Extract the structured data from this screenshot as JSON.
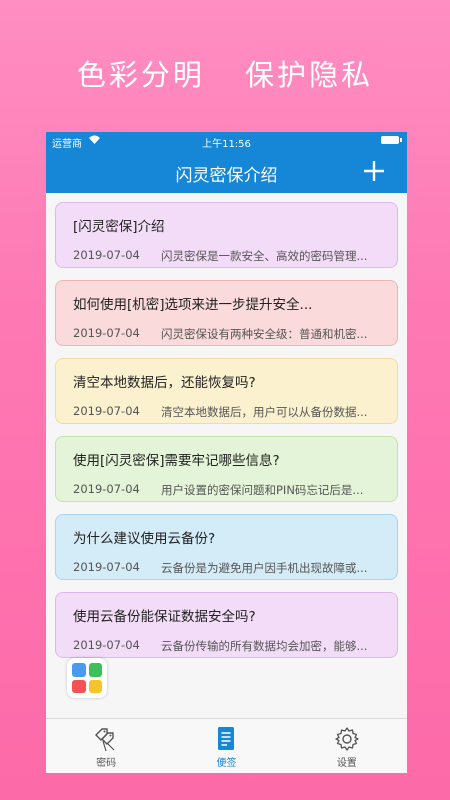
{
  "promo": {
    "left": "色彩分明",
    "right": "保护隐私"
  },
  "status_bar": {
    "carrier": "运营商",
    "time": "上午11:56"
  },
  "navbar": {
    "title": "闪灵密保介绍",
    "add_icon": "plus-icon"
  },
  "notes": [
    {
      "title": "[闪灵密保]介绍",
      "date": "2019-07-04",
      "summary": "闪灵密保是一款安全、高效的密码管理...",
      "bg": "#f3dcf8",
      "border": "#dfb8ea"
    },
    {
      "title": "如何使用[机密]选项来进一步提升安全...",
      "date": "2019-07-04",
      "summary": "闪灵密保设有两种安全级：普通和机密...",
      "bg": "#fadadb",
      "border": "#f0b4b6"
    },
    {
      "title": "清空本地数据后，还能恢复吗?",
      "date": "2019-07-04",
      "summary": "清空本地数据后，用户可以从备份数据...",
      "bg": "#fbf1cf",
      "border": "#efdca0"
    },
    {
      "title": "使用[闪灵密保]需要牢记哪些信息?",
      "date": "2019-07-04",
      "summary": "用户设置的密保问题和PIN码忘记后是...",
      "bg": "#e4f4d8",
      "border": "#c3e3ad"
    },
    {
      "title": "为什么建议使用云备份?",
      "date": "2019-07-04",
      "summary": "云备份是为避免用户因手机出现故障或...",
      "bg": "#d4ebf8",
      "border": "#a9d3ee"
    },
    {
      "title": "使用云备份能保证数据安全吗?",
      "date": "2019-07-04",
      "summary": "云备份传输的所有数据均会加密，能够...",
      "bg": "#f3dcf8",
      "border": "#dfb8ea"
    }
  ],
  "floating_app_icon": {
    "name": "app-grid-icon",
    "colors": [
      "#4a9bf0",
      "#3cc05a",
      "#f25252",
      "#f7c52a"
    ]
  },
  "tabbar": {
    "items": [
      {
        "label": "密码",
        "icon": "tags-icon"
      },
      {
        "label": "便签",
        "icon": "note-icon",
        "active": true
      },
      {
        "label": "设置",
        "icon": "gear-icon"
      }
    ]
  },
  "colors": {
    "accent": "#1687d6",
    "background_pink": "#fe78b3"
  }
}
